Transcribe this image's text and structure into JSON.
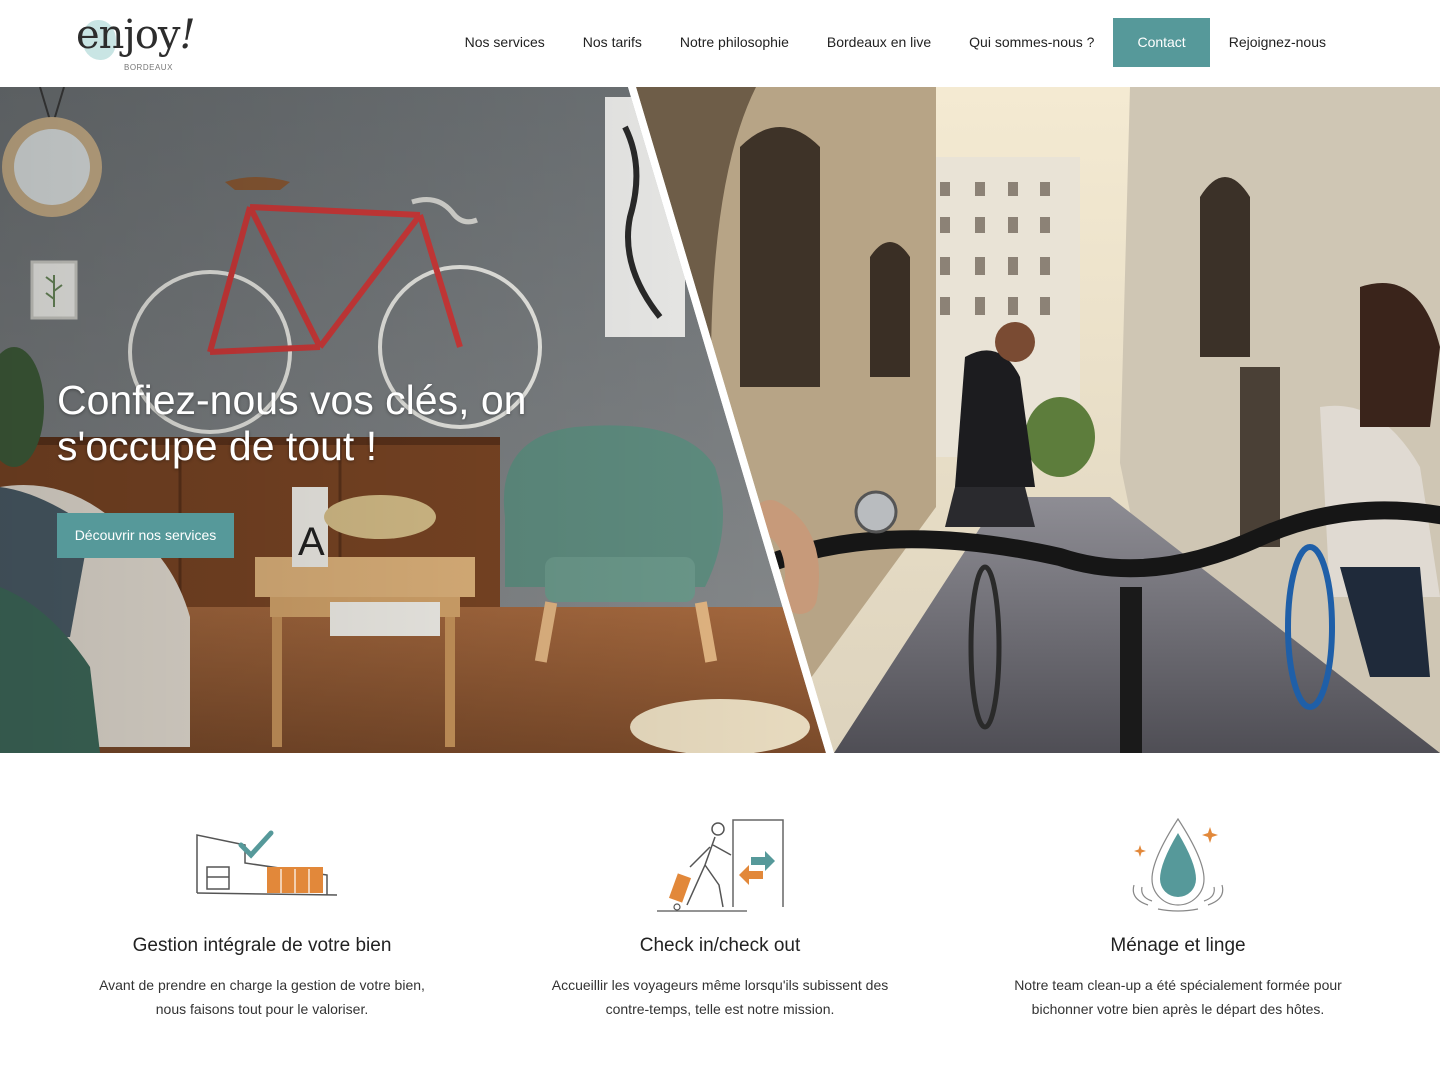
{
  "logo": {
    "wordmark": "enjoy",
    "exclamation": "!",
    "subtitle": "BORDEAUX"
  },
  "nav": {
    "items": [
      {
        "label": "Nos services"
      },
      {
        "label": "Nos tarifs"
      },
      {
        "label": "Notre philosophie"
      },
      {
        "label": "Bordeaux en live"
      },
      {
        "label": "Qui sommes-nous ?"
      }
    ],
    "contact": "Contact",
    "join": "Rejoignez-nous"
  },
  "hero": {
    "title": "Confiez-nous vos clés, on s'occupe de tout !",
    "cta": "Découvrir nos services"
  },
  "features": [
    {
      "icon": "house-check-icon",
      "title": "Gestion intégrale de votre bien",
      "text": "Avant de prendre en charge la gestion de votre bien, nous faisons tout pour le valoriser."
    },
    {
      "icon": "traveler-door-icon",
      "title": "Check in/check out",
      "text": "Accueillir les voyageurs même lorsqu'ils subissent des contre-temps, telle est notre mission."
    },
    {
      "icon": "water-drop-sparkle-icon",
      "title": "Ménage et linge",
      "text": "Notre team clean-up a été spécialement formée pour bichonner votre bien après le départ des hôtes."
    }
  ],
  "colors": {
    "accent": "#56999a",
    "orange": "#e2883a",
    "text": "#222222"
  }
}
